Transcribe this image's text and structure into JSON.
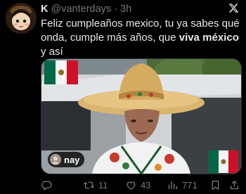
{
  "tweet": {
    "author_name": "K",
    "handle": "@vanterdays",
    "separator": "·",
    "time": "3h",
    "text_part1": "Feliz cumpleaños mexico, tu ya sabes qué onda, cumple más años, que ",
    "text_bold": "viva méxico",
    "text_part2": " y así"
  },
  "media": {
    "tag_user": "nay"
  },
  "actions": {
    "reply_icon": "reply-icon",
    "retweets": "11",
    "likes": "43",
    "views": "771",
    "bookmark_icon": "bookmark-icon",
    "share_icon": "share-icon"
  },
  "colors": {
    "background": "#000000",
    "text": "#e7e9ea",
    "muted": "#71767b",
    "mexico_green": "#006847",
    "mexico_red": "#ce1126"
  }
}
